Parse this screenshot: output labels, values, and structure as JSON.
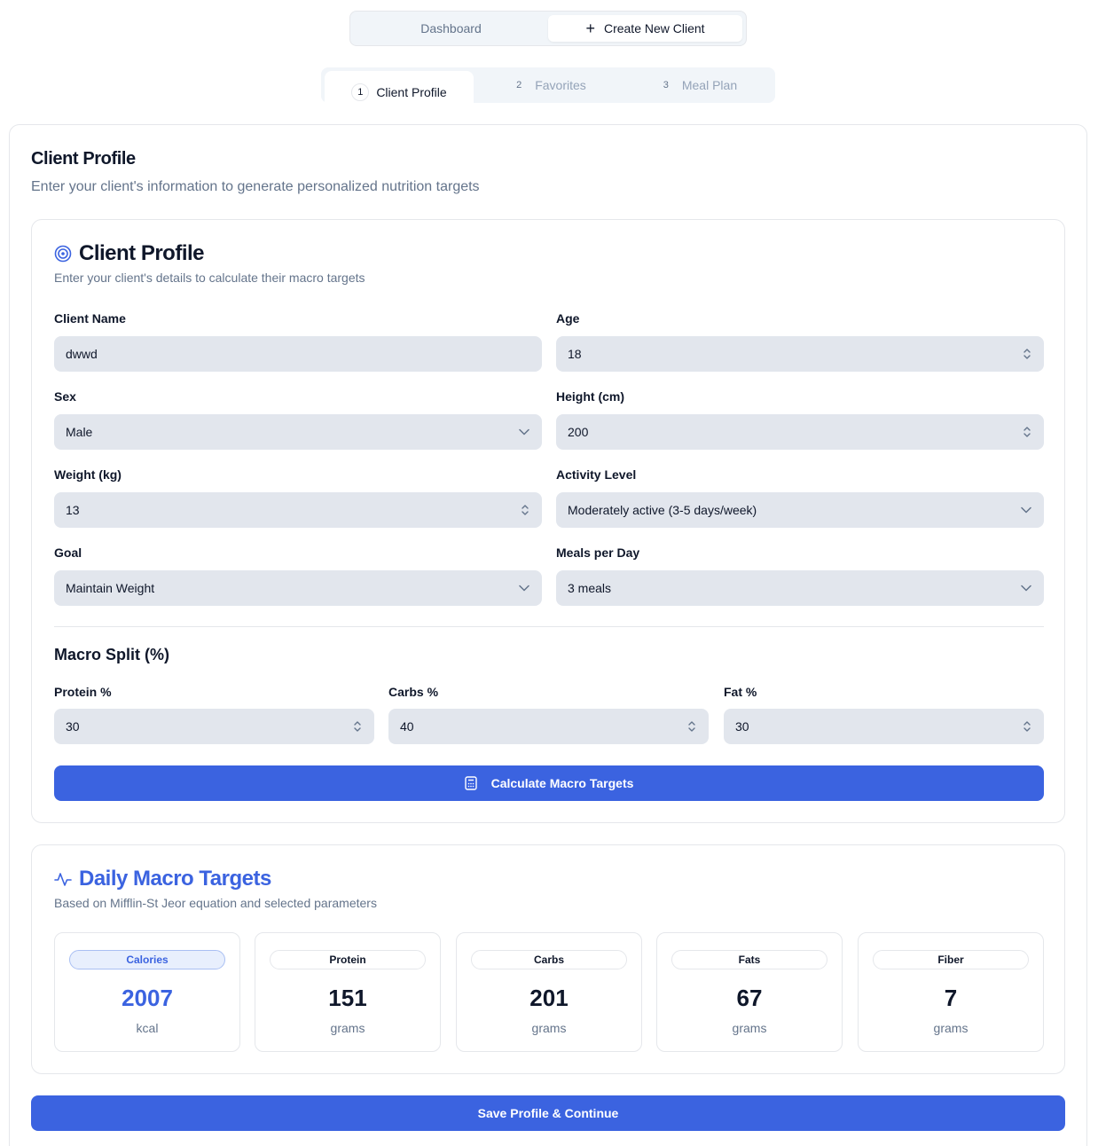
{
  "top_tabs": {
    "dashboard": "Dashboard",
    "create": "Create New Client",
    "create_icon": "+"
  },
  "steps": [
    {
      "num": "1",
      "label": "Client Profile",
      "active": true
    },
    {
      "num": "2",
      "label": "Favorites",
      "active": false
    },
    {
      "num": "3",
      "label": "Meal Plan",
      "active": false
    }
  ],
  "page": {
    "title": "Client Profile",
    "subtitle": "Enter your client's information to generate personalized nutrition targets"
  },
  "profile_card": {
    "title": "Client Profile",
    "description": "Enter your client's details to calculate their macro targets",
    "icon": "target-icon",
    "fields": {
      "client_name": {
        "label": "Client Name",
        "value": "dwwd"
      },
      "age": {
        "label": "Age",
        "value": "18"
      },
      "sex": {
        "label": "Sex",
        "value": "Male"
      },
      "height": {
        "label": "Height (cm)",
        "value": "200"
      },
      "weight": {
        "label": "Weight (kg)",
        "value": "13"
      },
      "activity": {
        "label": "Activity Level",
        "value": "Moderately active (3-5 days/week)"
      },
      "goal": {
        "label": "Goal",
        "value": "Maintain Weight"
      },
      "meals": {
        "label": "Meals per Day",
        "value": "3 meals"
      }
    },
    "macro_split": {
      "title": "Macro Split (%)",
      "protein": {
        "label": "Protein %",
        "value": "30"
      },
      "carbs": {
        "label": "Carbs %",
        "value": "40"
      },
      "fat": {
        "label": "Fat %",
        "value": "30"
      }
    },
    "calculate_button": "Calculate Macro Targets"
  },
  "targets_card": {
    "title": "Daily Macro Targets",
    "description": "Based on Mifflin-St Jeor equation and selected parameters",
    "icon": "activity-icon",
    "stats": [
      {
        "label": "Calories",
        "value": "2007",
        "unit": "kcal"
      },
      {
        "label": "Protein",
        "value": "151",
        "unit": "grams"
      },
      {
        "label": "Carbs",
        "value": "201",
        "unit": "grams"
      },
      {
        "label": "Fats",
        "value": "67",
        "unit": "grams"
      },
      {
        "label": "Fiber",
        "value": "7",
        "unit": "grams"
      }
    ]
  },
  "save_button": "Save Profile & Continue",
  "colors": {
    "primary": "#3b63e0",
    "input_bg": "#e2e6ed",
    "muted_text": "#64748b"
  }
}
